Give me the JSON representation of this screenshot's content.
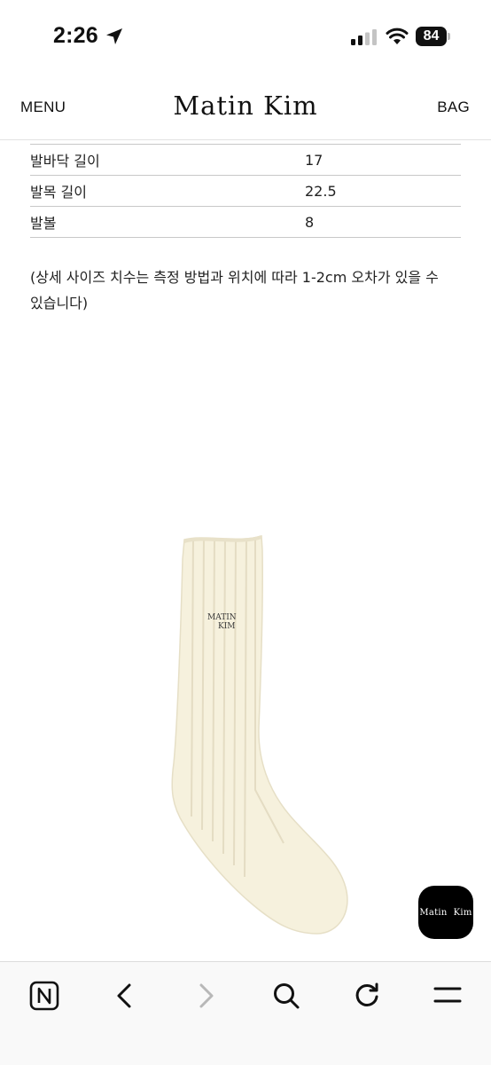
{
  "status_bar": {
    "time": "2:26",
    "battery_level": "84",
    "icons": [
      "location-arrow-icon",
      "cellular-signal-icon",
      "wifi-icon",
      "battery-icon"
    ]
  },
  "header": {
    "menu_label": "MENU",
    "logo": "Matin Kim",
    "bag_label": "BAG"
  },
  "size_table": {
    "rows": [
      {
        "label": "발바닥 길이",
        "value": "17"
      },
      {
        "label": "발목 길이",
        "value": "22.5"
      },
      {
        "label": "발볼",
        "value": "8"
      }
    ]
  },
  "size_note": "(상세 사이즈 치수는 측정 방법과 위치에 따라 1-2cm 오차가 있을 수 있습니다)",
  "product_image": {
    "embroidery_line1": "MATIN",
    "embroidery_line2": "KIM",
    "colors": {
      "sock": "#f6f1dd",
      "rib_shadow": "#e4dcc3",
      "embroidery": "#3a3a3a"
    }
  },
  "float_button": {
    "label": "Matin  Kim"
  },
  "toolbar": {
    "icons": [
      "n-app-icon",
      "back-arrow-icon",
      "forward-arrow-icon",
      "search-icon",
      "reload-icon",
      "menu-lines-icon"
    ]
  },
  "colors": {
    "text": "#111111",
    "divider": "#c8c8c8",
    "toolbar_bg": "#f9f9f9",
    "disabled": "#b8b8b8"
  }
}
